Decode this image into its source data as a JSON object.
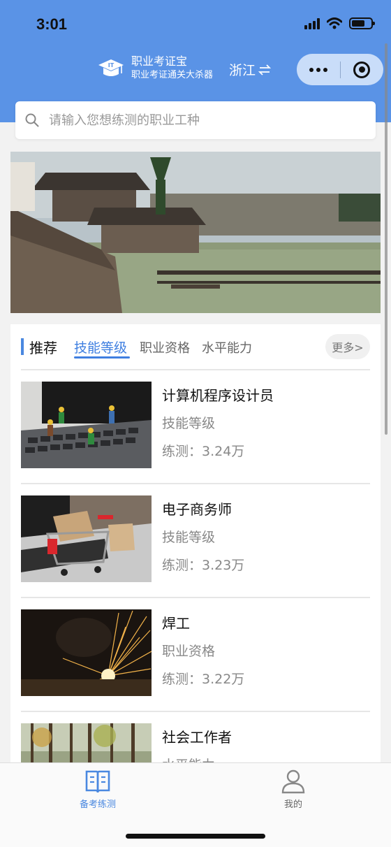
{
  "status_bar": {
    "time": "3:01",
    "battery_level": 0.7
  },
  "header": {
    "app_title": "职业考证宝",
    "app_subtitle": "职业考证通关大杀器",
    "region": "浙江",
    "region_icon": "swap-icon",
    "colors": {
      "primary": "#5a93e6",
      "accent": "#3f7fe0"
    }
  },
  "search": {
    "placeholder": "请输入您想练测的职业工种"
  },
  "section": {
    "title": "推荐",
    "tabs": [
      "技能等级",
      "职业资格",
      "水平能力"
    ],
    "active_tab": 0,
    "more_label": "更多>"
  },
  "list": {
    "items": [
      {
        "name": "计算机程序设计员",
        "category": "技能等级",
        "count": "练测：3.24万"
      },
      {
        "name": "电子商务师",
        "category": "技能等级",
        "count": "练测：3.23万"
      },
      {
        "name": "焊工",
        "category": "职业资格",
        "count": "练测：3.22万"
      },
      {
        "name": "社会工作者",
        "category": "水平能力",
        "count": ""
      }
    ]
  },
  "tabbar": {
    "items": [
      {
        "label": "备考练测",
        "icon": "book-icon",
        "active": true
      },
      {
        "label": "我的",
        "icon": "user-icon",
        "active": false
      }
    ]
  }
}
